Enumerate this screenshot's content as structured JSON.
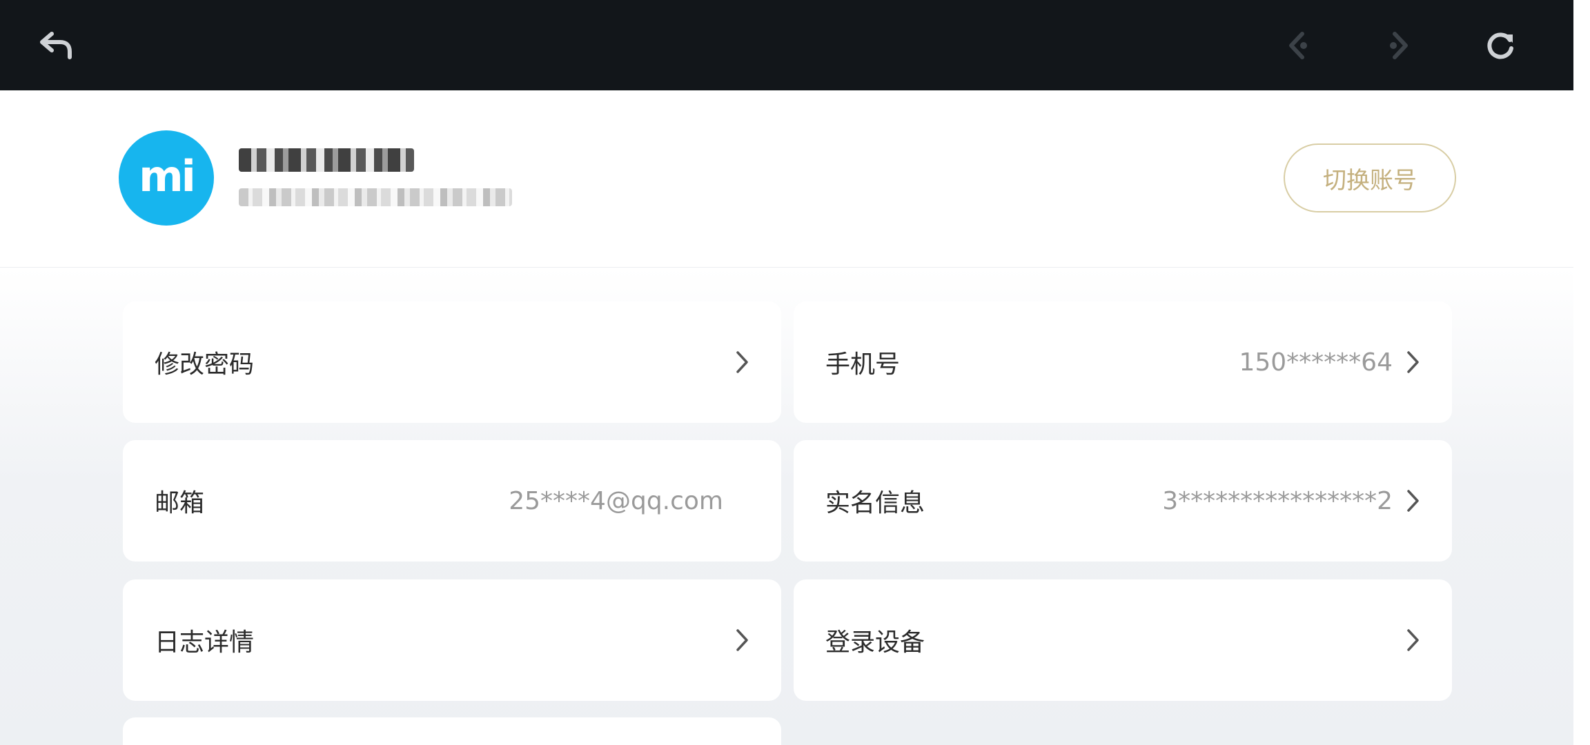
{
  "toolbar": {
    "back": "back-arrow-icon",
    "prev": "prev-icon",
    "next": "next-icon",
    "refresh": "refresh-icon"
  },
  "profile": {
    "avatar_text": "mi",
    "switch_account_label": "切换账号"
  },
  "cards": {
    "change_password": {
      "label": "修改密码"
    },
    "phone": {
      "label": "手机号",
      "value": "150******64"
    },
    "email": {
      "label": "邮箱",
      "value": "25****4@qq.com"
    },
    "real_name": {
      "label": "实名信息",
      "value": "3****************2"
    },
    "log_details": {
      "label": "日志详情"
    },
    "login_devices": {
      "label": "登录设备"
    }
  },
  "colors": {
    "toolbar_bg": "#12161a",
    "avatar_bg": "#17b5ee",
    "gold_accent": "#c4b07e"
  }
}
